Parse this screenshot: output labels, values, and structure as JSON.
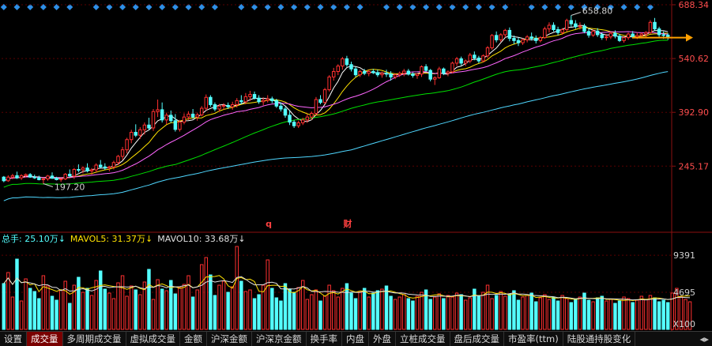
{
  "chart_data": [
    {
      "type": "candlestick",
      "name": "price",
      "y_axis_ticks": [
        688.34,
        540.62,
        392.9,
        245.17
      ],
      "ylim": [
        120,
        688.34
      ],
      "annotations": {
        "high_label": "658.80",
        "low_label": "197.20",
        "markers": [
          "q",
          "财"
        ]
      },
      "moving_averages": [
        {
          "color": "#ffffff"
        },
        {
          "color": "#ffe200"
        },
        {
          "color": "#ff66ff"
        },
        {
          "color": "#00e000"
        },
        {
          "color": "#4fd7ff"
        }
      ],
      "ohlc": [
        [
          215,
          218,
          201,
          205
        ],
        [
          205,
          220,
          202,
          215
        ],
        [
          215,
          224,
          209,
          219
        ],
        [
          219,
          230,
          210,
          213
        ],
        [
          213,
          223,
          207,
          219
        ],
        [
          219,
          225,
          214,
          222
        ],
        [
          222,
          226,
          213,
          215
        ],
        [
          215,
          222,
          210,
          213
        ],
        [
          213,
          219,
          206,
          208
        ],
        [
          208,
          213,
          197,
          210
        ],
        [
          210,
          221,
          205,
          218
        ],
        [
          218,
          228,
          210,
          212
        ],
        [
          212,
          216,
          206,
          208
        ],
        [
          208,
          213,
          202,
          210
        ],
        [
          210,
          226,
          207,
          223
        ],
        [
          223,
          236,
          215,
          218
        ],
        [
          218,
          240,
          210,
          236
        ],
        [
          236,
          250,
          228,
          235
        ],
        [
          235,
          245,
          225,
          240
        ],
        [
          240,
          253,
          228,
          232
        ],
        [
          232,
          240,
          222,
          235
        ],
        [
          235,
          253,
          228,
          248
        ],
        [
          248,
          262,
          240,
          243
        ],
        [
          243,
          253,
          235,
          240
        ],
        [
          240,
          246,
          231,
          243
        ],
        [
          243,
          260,
          236,
          255
        ],
        [
          255,
          276,
          248,
          272
        ],
        [
          272,
          298,
          262,
          290
        ],
        [
          290,
          323,
          280,
          318
        ],
        [
          318,
          345,
          308,
          338
        ],
        [
          338,
          360,
          325,
          330
        ],
        [
          330,
          352,
          320,
          345
        ],
        [
          345,
          365,
          332,
          358
        ],
        [
          358,
          378,
          344,
          350
        ],
        [
          350,
          402,
          342,
          395
        ],
        [
          395,
          428,
          380,
          400
        ],
        [
          400,
          420,
          365,
          372
        ],
        [
          372,
          392,
          360,
          385
        ],
        [
          385,
          398,
          364,
          370
        ],
        [
          370,
          388,
          340,
          346
        ],
        [
          346,
          372,
          340,
          366
        ],
        [
          366,
          390,
          360,
          380
        ],
        [
          380,
          396,
          372,
          388
        ],
        [
          388,
          402,
          375,
          380
        ],
        [
          380,
          392,
          370,
          386
        ],
        [
          386,
          410,
          382,
          404
        ],
        [
          404,
          442,
          398,
          434
        ],
        [
          434,
          440,
          408,
          414
        ],
        [
          414,
          420,
          396,
          402
        ],
        [
          402,
          416,
          395,
          410
        ],
        [
          410,
          418,
          400,
          412
        ],
        [
          412,
          420,
          402,
          408
        ],
        [
          408,
          422,
          400,
          414
        ],
        [
          414,
          432,
          406,
          425
        ],
        [
          425,
          440,
          415,
          422
        ],
        [
          422,
          446,
          415,
          436
        ],
        [
          436,
          452,
          424,
          442
        ],
        [
          442,
          450,
          428,
          432
        ],
        [
          432,
          440,
          416,
          422
        ],
        [
          422,
          434,
          412,
          426
        ],
        [
          426,
          440,
          420,
          430
        ],
        [
          430,
          436,
          418,
          425
        ],
        [
          425,
          430,
          405,
          410
        ],
        [
          410,
          420,
          395,
          402
        ],
        [
          402,
          408,
          378,
          385
        ],
        [
          385,
          398,
          358,
          366
        ],
        [
          366,
          372,
          350,
          356
        ],
        [
          356,
          370,
          350,
          364
        ],
        [
          364,
          378,
          358,
          372
        ],
        [
          372,
          388,
          364,
          380
        ],
        [
          380,
          395,
          372,
          390
        ],
        [
          390,
          435,
          385,
          428
        ],
        [
          428,
          440,
          415,
          420
        ],
        [
          420,
          460,
          415,
          455
        ],
        [
          455,
          495,
          450,
          490
        ],
        [
          490,
          515,
          480,
          505
        ],
        [
          505,
          525,
          495,
          520
        ],
        [
          520,
          545,
          510,
          540
        ],
        [
          540,
          548,
          518,
          524
        ],
        [
          524,
          532,
          505,
          512
        ],
        [
          512,
          518,
          490,
          496
        ],
        [
          496,
          510,
          490,
          505
        ],
        [
          505,
          512,
          495,
          500
        ],
        [
          500,
          510,
          492,
          505
        ],
        [
          505,
          512,
          498,
          502
        ],
        [
          502,
          510,
          490,
          496
        ],
        [
          496,
          505,
          488,
          500
        ],
        [
          500,
          510,
          490,
          498
        ],
        [
          498,
          506,
          480,
          490
        ],
        [
          490,
          500,
          484,
          496
        ],
        [
          496,
          505,
          490,
          500
        ],
        [
          500,
          512,
          492,
          506
        ],
        [
          506,
          512,
          494,
          498
        ],
        [
          498,
          503,
          488,
          494
        ],
        [
          494,
          500,
          485,
          498
        ],
        [
          498,
          522,
          490,
          518
        ],
        [
          518,
          525,
          505,
          508
        ],
        [
          508,
          512,
          478,
          484
        ],
        [
          484,
          492,
          468,
          488
        ],
        [
          488,
          518,
          485,
          512
        ],
        [
          512,
          516,
          495,
          500
        ],
        [
          500,
          508,
          492,
          504
        ],
        [
          504,
          532,
          500,
          528
        ],
        [
          528,
          545,
          520,
          540
        ],
        [
          540,
          546,
          522,
          528
        ],
        [
          528,
          538,
          520,
          534
        ],
        [
          534,
          556,
          528,
          550
        ],
        [
          550,
          560,
          536,
          542
        ],
        [
          542,
          548,
          528,
          534
        ],
        [
          534,
          552,
          530,
          548
        ],
        [
          548,
          575,
          542,
          570
        ],
        [
          570,
          608,
          565,
          604
        ],
        [
          604,
          615,
          585,
          592
        ],
        [
          592,
          610,
          586,
          606
        ],
        [
          606,
          622,
          598,
          618
        ],
        [
          618,
          626,
          588,
          596
        ],
        [
          596,
          604,
          580,
          590
        ],
        [
          590,
          598,
          575,
          584
        ],
        [
          584,
          596,
          578,
          592
        ],
        [
          592,
          605,
          585,
          600
        ],
        [
          600,
          612,
          590,
          596
        ],
        [
          596,
          604,
          582,
          590
        ],
        [
          590,
          602,
          585,
          598
        ],
        [
          598,
          628,
          595,
          622
        ],
        [
          622,
          640,
          612,
          632
        ],
        [
          632,
          640,
          615,
          620
        ],
        [
          620,
          628,
          605,
          612
        ],
        [
          612,
          624,
          606,
          620
        ],
        [
          620,
          650,
          615,
          645
        ],
        [
          645,
          659,
          628,
          636
        ],
        [
          636,
          646,
          622,
          628
        ],
        [
          628,
          640,
          620,
          630
        ],
        [
          630,
          636,
          610,
          615
        ],
        [
          615,
          622,
          598,
          605
        ],
        [
          605,
          620,
          600,
          616
        ],
        [
          616,
          624,
          600,
          606
        ],
        [
          606,
          612,
          592,
          598
        ],
        [
          598,
          608,
          590,
          600
        ],
        [
          600,
          614,
          594,
          610
        ],
        [
          610,
          618,
          596,
          602
        ],
        [
          602,
          608,
          586,
          590
        ],
        [
          590,
          602,
          584,
          598
        ],
        [
          598,
          612,
          592,
          608
        ],
        [
          608,
          616,
          596,
          600
        ],
        [
          600,
          612,
          594,
          604
        ],
        [
          604,
          612,
          596,
          608
        ],
        [
          608,
          616,
          600,
          612
        ],
        [
          612,
          646,
          608,
          640
        ],
        [
          640,
          652,
          618,
          622
        ],
        [
          622,
          628,
          600,
          606
        ],
        [
          606,
          615,
          595,
          605
        ],
        [
          605,
          610,
          592,
          598
        ]
      ]
    },
    {
      "type": "bar",
      "name": "volume",
      "header": {
        "total": "总手: 25.10万↓",
        "mavol5": "MAVOL5: 31.37万↓",
        "mavol10": "MAVOL10: 33.68万↓"
      },
      "y_axis_ticks": [
        9391,
        4695
      ],
      "unit_label": "X100",
      "ylim": [
        0,
        11200
      ],
      "colors": {
        "up": "#ff3030",
        "down": "#54ffff"
      },
      "values": [
        5800,
        7200,
        4100,
        8900,
        3600,
        6400,
        5200,
        4800,
        3900,
        6800,
        5500,
        4200,
        3700,
        5000,
        6100,
        3300,
        5600,
        6600,
        4700,
        5200,
        4300,
        6200,
        7400,
        5100,
        4600,
        3900,
        5900,
        6800,
        4200,
        5500,
        5000,
        4400,
        6000,
        7600,
        3800,
        6300,
        5100,
        4900,
        6200,
        4500,
        5300,
        5700,
        6800,
        4100,
        5000,
        8200,
        9100,
        6900,
        4300,
        5600,
        6100,
        4700,
        5400,
        10500,
        6100,
        4800,
        5000,
        3900,
        4400,
        5600,
        8800,
        5200,
        4000,
        3600,
        5800,
        5100,
        4700,
        5300,
        6200,
        3800,
        4400,
        5000,
        3600,
        4200,
        5600,
        4900,
        4100,
        5200,
        5800,
        4600,
        3900,
        4800,
        5200,
        4100,
        4600,
        4900,
        5100,
        5500,
        4200,
        3800,
        4100,
        4400,
        3900,
        3600,
        4200,
        4700,
        5000,
        3800,
        4100,
        4500,
        3900,
        4300,
        4100,
        4600,
        4400,
        3700,
        4000,
        5100,
        4200,
        4700,
        5600,
        3900,
        4300,
        4800,
        4200,
        4500,
        4900,
        3700,
        4100,
        4300,
        4600,
        3500,
        4000,
        4400,
        3800,
        4100,
        3600,
        4300,
        3900,
        3400,
        3800,
        4100,
        4600,
        3700,
        3500,
        4000,
        4200,
        3600,
        3800,
        3300,
        3600,
        4100,
        3900,
        3400,
        3700,
        4200,
        3800,
        4300,
        4000,
        3500,
        3700,
        3400,
        4600,
        5200,
        4100,
        3800,
        3500
      ]
    }
  ],
  "tabs": [
    "设置",
    "成交量",
    "多周期成交量",
    "虚拟成交量",
    "金额",
    "沪深金额",
    "沪深京金额",
    "换手率",
    "内盘",
    "外盘",
    "立桩成交量",
    "盘后成交量",
    "市盈率(ttm)",
    "陆股通持股变化"
  ],
  "tab_scroll": "◂▸",
  "colors": {
    "up": "#ff3030",
    "down": "#54ffff",
    "axis_text": "#ff4d4d",
    "arrow": "#ffa000",
    "diamond": "#2f8fe6"
  }
}
